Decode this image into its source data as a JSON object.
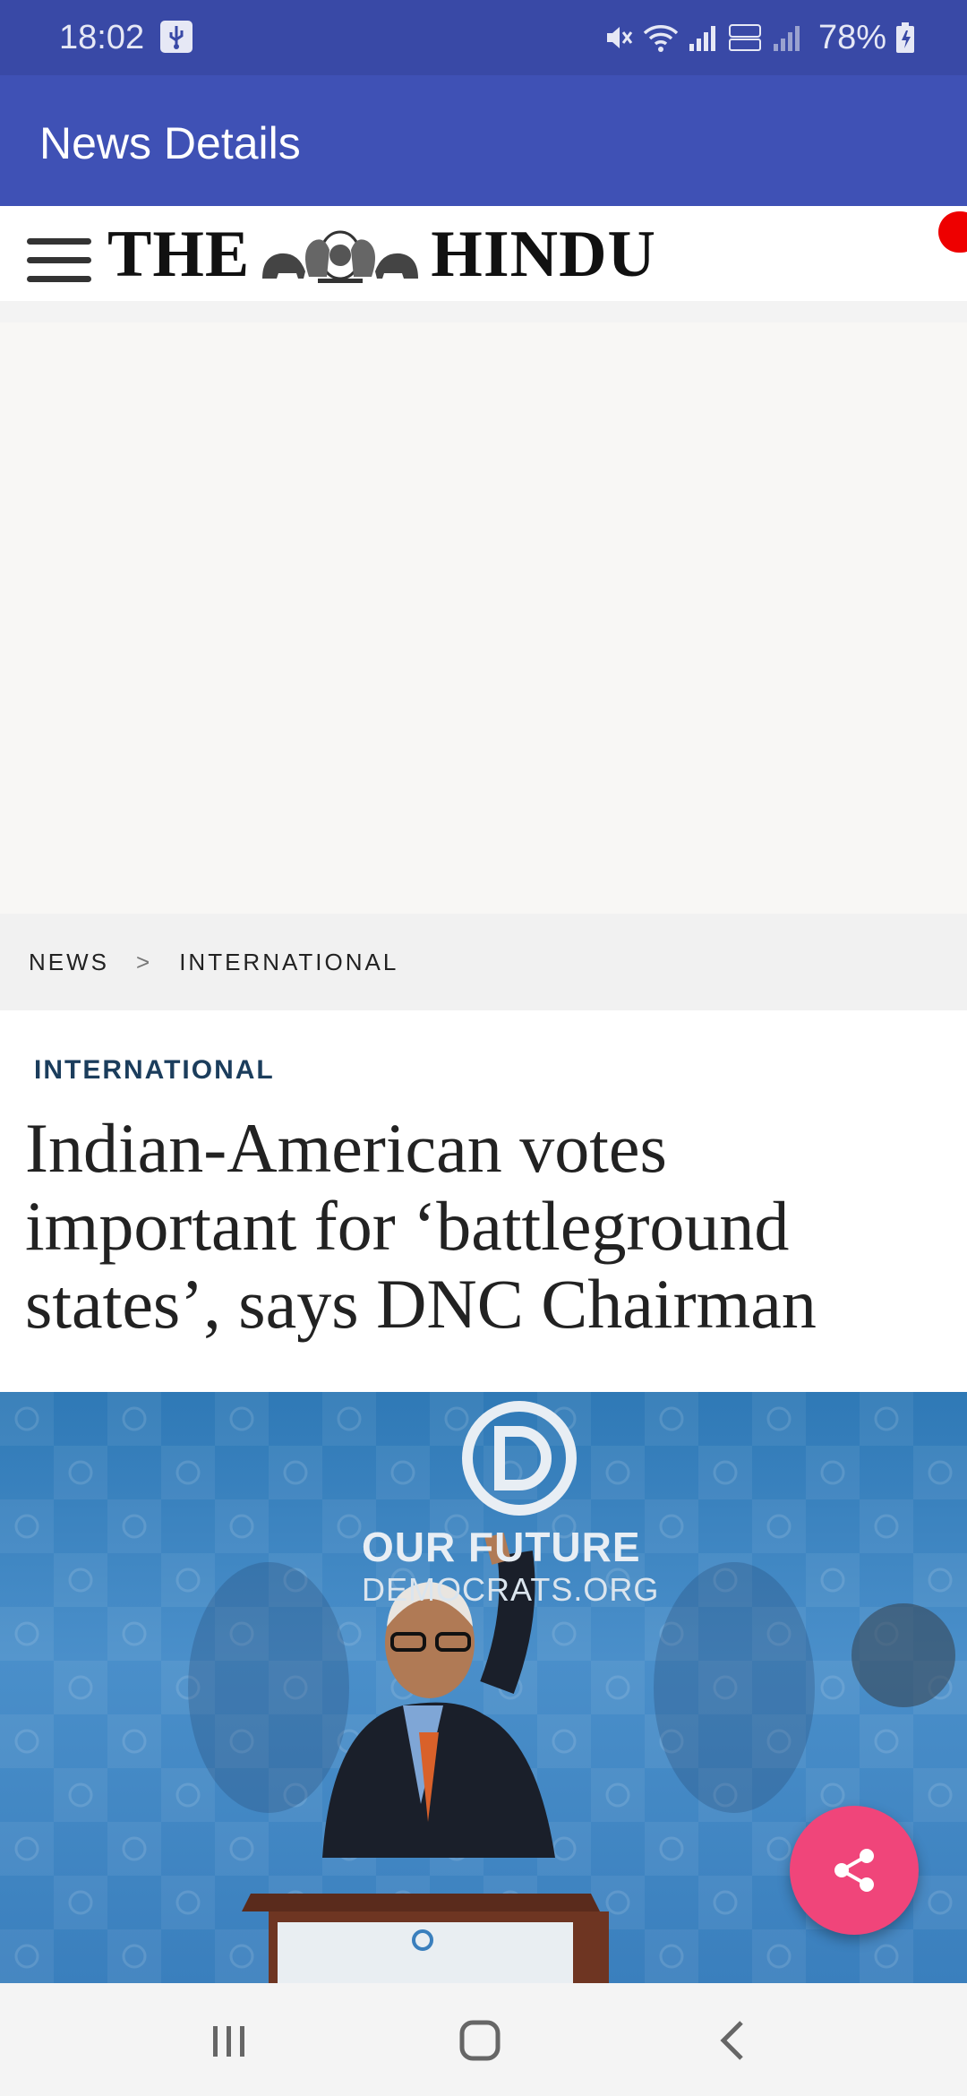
{
  "status_bar": {
    "time": "18:02",
    "battery_percent": "78%",
    "icons": [
      "usb-icon",
      "mute-icon",
      "wifi-icon",
      "signal-icon",
      "volte-icon",
      "signal-icon",
      "battery-icon"
    ]
  },
  "app_bar": {
    "title": "News Details"
  },
  "site_header": {
    "logo_text_left": "THE",
    "logo_text_right": "HINDU"
  },
  "breadcrumb": {
    "items": [
      "NEWS",
      "INTERNATIONAL"
    ],
    "separator": ">"
  },
  "article": {
    "section": "INTERNATIONAL",
    "headline": "Indian-American votes important for ‘battleground states’, says DNC Chairman",
    "photo": {
      "backdrop_text_line1": "OUR FUTURE",
      "backdrop_text_line2": "DEMOCRATS.ORG",
      "backdrop_logo": "D"
    }
  },
  "colors": {
    "status_bar": "#3949a6",
    "app_bar": "#3f51b5",
    "section_label": "#1b3d5c",
    "share_fab": "#f0457a"
  }
}
